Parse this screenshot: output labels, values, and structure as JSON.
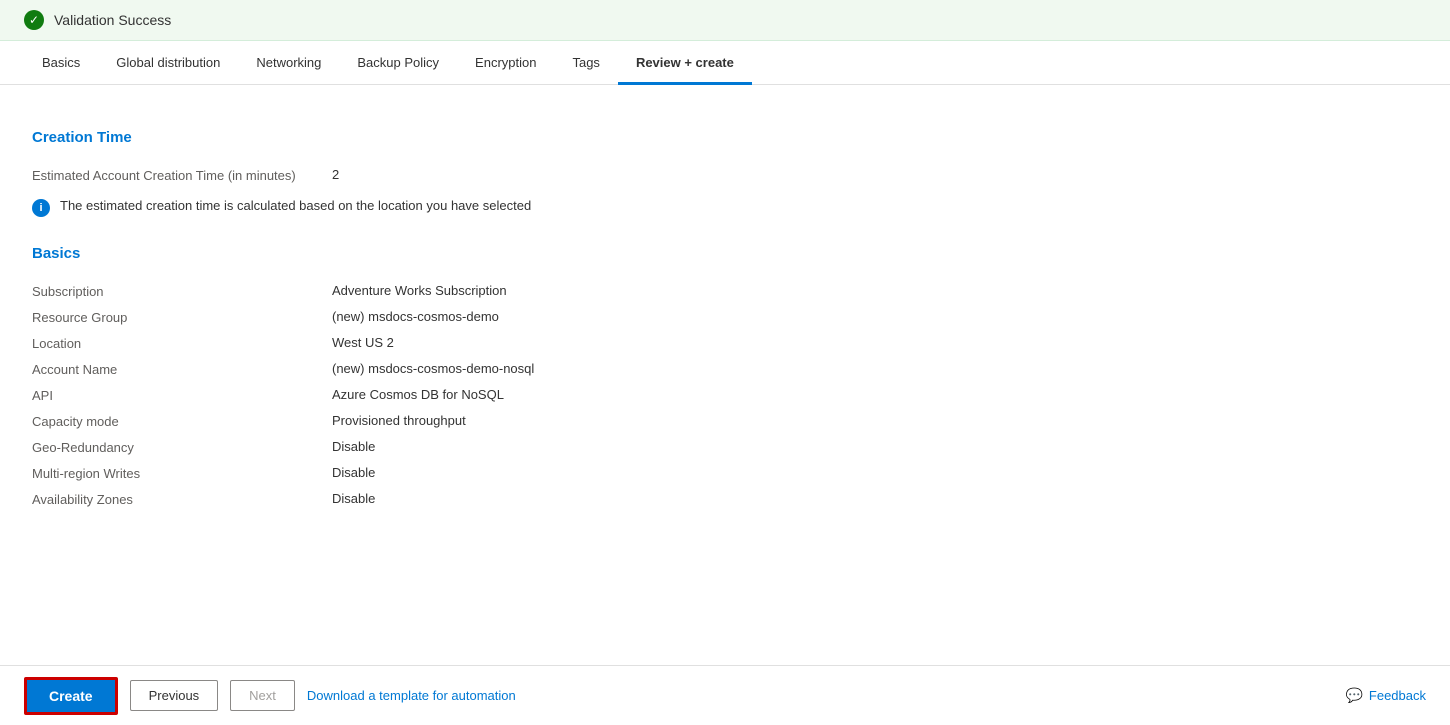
{
  "validation": {
    "icon": "✓",
    "message": "Validation Success"
  },
  "tabs": {
    "items": [
      {
        "id": "basics",
        "label": "Basics",
        "active": false
      },
      {
        "id": "global-distribution",
        "label": "Global distribution",
        "active": false
      },
      {
        "id": "networking",
        "label": "Networking",
        "active": false
      },
      {
        "id": "backup-policy",
        "label": "Backup Policy",
        "active": false
      },
      {
        "id": "encryption",
        "label": "Encryption",
        "active": false
      },
      {
        "id": "tags",
        "label": "Tags",
        "active": false
      },
      {
        "id": "review-create",
        "label": "Review + create",
        "active": true
      }
    ]
  },
  "creation_time": {
    "section_title": "Creation Time",
    "fields": [
      {
        "label": "Estimated Account Creation Time (in minutes)",
        "value": "2"
      }
    ],
    "info_message": "The estimated creation time is calculated based on the location you have selected"
  },
  "basics": {
    "section_title": "Basics",
    "fields": [
      {
        "label": "Subscription",
        "value": "Adventure Works Subscription"
      },
      {
        "label": "Resource Group",
        "value": "(new) msdocs-cosmos-demo"
      },
      {
        "label": "Location",
        "value": "West US 2"
      },
      {
        "label": "Account Name",
        "value": "(new) msdocs-cosmos-demo-nosql"
      },
      {
        "label": "API",
        "value": "Azure Cosmos DB for NoSQL"
      },
      {
        "label": "Capacity mode",
        "value": "Provisioned throughput"
      },
      {
        "label": "Geo-Redundancy",
        "value": "Disable"
      },
      {
        "label": "Multi-region Writes",
        "value": "Disable"
      },
      {
        "label": "Availability Zones",
        "value": "Disable"
      }
    ]
  },
  "footer": {
    "create_label": "Create",
    "previous_label": "Previous",
    "next_label": "Next",
    "automation_link": "Download a template for automation",
    "feedback_label": "Feedback"
  }
}
